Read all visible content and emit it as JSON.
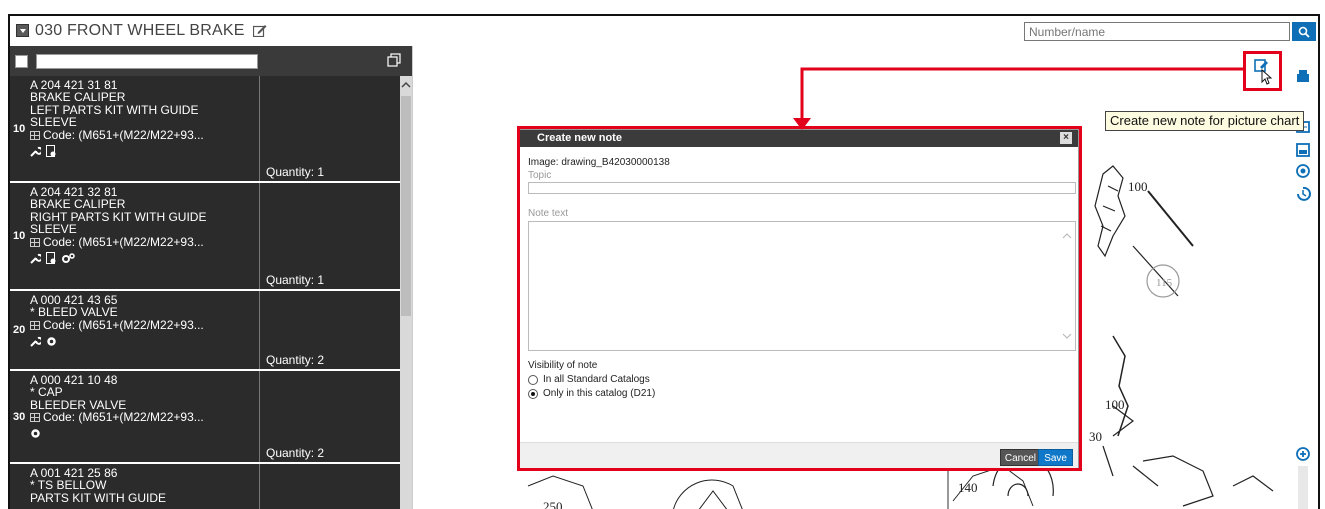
{
  "header": {
    "title": "030 FRONT WHEEL BRAKE",
    "search_placeholder": "Number/name"
  },
  "parts": [
    {
      "position": "10",
      "number": "A 204 421 31 81",
      "lines": [
        "BRAKE CALIPER",
        "LEFT PARTS KIT WITH GUIDE",
        "SLEEVE"
      ],
      "code": "Code: (M651+(M22/M22+93...",
      "quantity": "Quantity: 1"
    },
    {
      "position": "10",
      "number": "A 204 421 32 81",
      "lines": [
        "BRAKE CALIPER",
        "RIGHT PARTS KIT WITH GUIDE",
        "SLEEVE"
      ],
      "code": "Code: (M651+(M22/M22+93...",
      "quantity": "Quantity: 1"
    },
    {
      "position": "20",
      "number": "A 000 421 43 65",
      "lines": [
        "* BLEED VALVE"
      ],
      "code": "Code: (M651+(M22/M22+93...",
      "quantity": "Quantity: 2"
    },
    {
      "position": "30",
      "number": "A 000 421 10 48",
      "lines": [
        "* CAP",
        "BLEEDER VALVE"
      ],
      "code": "Code: (M651+(M22/M22+93...",
      "quantity": "Quantity: 2"
    },
    {
      "position": "",
      "number": "A 001 421 25 86",
      "lines": [
        "* TS BELLOW",
        "PARTS KIT WITH GUIDE"
      ],
      "code": "",
      "quantity": ""
    }
  ],
  "dialog": {
    "title": "Create new note",
    "image_line": "Image: drawing_B42030000138",
    "topic_label": "Topic",
    "note_label": "Note text",
    "visibility_label": "Visibility of note",
    "option_all": "In all Standard Catalogs",
    "option_this": "Only in this catalog (D21)",
    "cancel": "Cancel",
    "save": "Save"
  },
  "tooltip": "Create new note for picture chart",
  "drawing_labels": {
    "l100a": "100",
    "l115": "115",
    "l100b": "100",
    "l30": "30",
    "l140": "140",
    "l250": "250"
  },
  "colors": {
    "highlight": "#e3001b",
    "accent": "#0f6fb6",
    "panel": "#2b2b2b"
  }
}
